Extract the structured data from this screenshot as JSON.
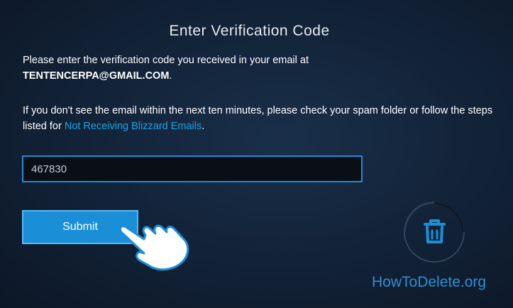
{
  "dialog": {
    "title": "Enter Verification Code",
    "instruction_text": "Please enter the verification code you received in your email at",
    "email": "TENTENCERPA@GMAIL.COM",
    "email_suffix": ".",
    "spam_text": "If you don't see the email within the next ten minutes, please check your spam folder or follow the steps listed for ",
    "link_label": "Not Receiving Blizzard Emails",
    "link_suffix": "."
  },
  "code_input": {
    "value": "467830"
  },
  "submit_label": "Submit",
  "overlay": {
    "hand_icon": "pointing-hand-cursor",
    "trash_icon": "trash-can",
    "watermark": "HowToDelete.org"
  },
  "colors": {
    "accent": "#1a8fd8",
    "link": "#1aa3e8",
    "background": "#13243a",
    "watermark": "#2d8fd4"
  }
}
